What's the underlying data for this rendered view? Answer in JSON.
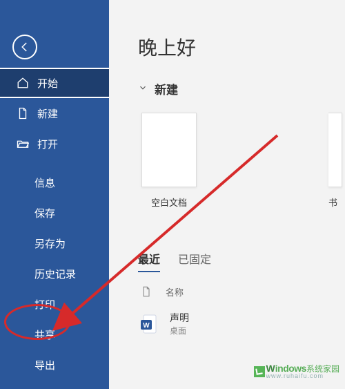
{
  "sidebar": {
    "items": [
      {
        "label": "开始",
        "icon": "home-icon",
        "active": true,
        "hasIcon": true
      },
      {
        "label": "新建",
        "icon": "document-icon",
        "active": false,
        "hasIcon": true
      },
      {
        "label": "打开",
        "icon": "folder-open-icon",
        "active": false,
        "hasIcon": true
      },
      {
        "label": "信息",
        "active": false,
        "hasIcon": false
      },
      {
        "label": "保存",
        "active": false,
        "hasIcon": false
      },
      {
        "label": "另存为",
        "active": false,
        "hasIcon": false
      },
      {
        "label": "历史记录",
        "active": false,
        "hasIcon": false
      },
      {
        "label": "打印",
        "active": false,
        "hasIcon": false
      },
      {
        "label": "共享",
        "active": false,
        "hasIcon": false
      },
      {
        "label": "导出",
        "active": false,
        "hasIcon": false
      }
    ]
  },
  "main": {
    "title": "晚上好",
    "new_section_label": "新建",
    "templates": [
      {
        "label": "空白文档"
      },
      {
        "label": "书"
      }
    ],
    "tabs": [
      {
        "label": "最近",
        "active": true
      },
      {
        "label": "已固定",
        "active": false
      }
    ],
    "file_header": {
      "name_col": "名称"
    },
    "files": [
      {
        "name": "声明",
        "location": "桌面"
      }
    ]
  },
  "watermark": {
    "brand": "indows",
    "sub": "系统家园"
  }
}
